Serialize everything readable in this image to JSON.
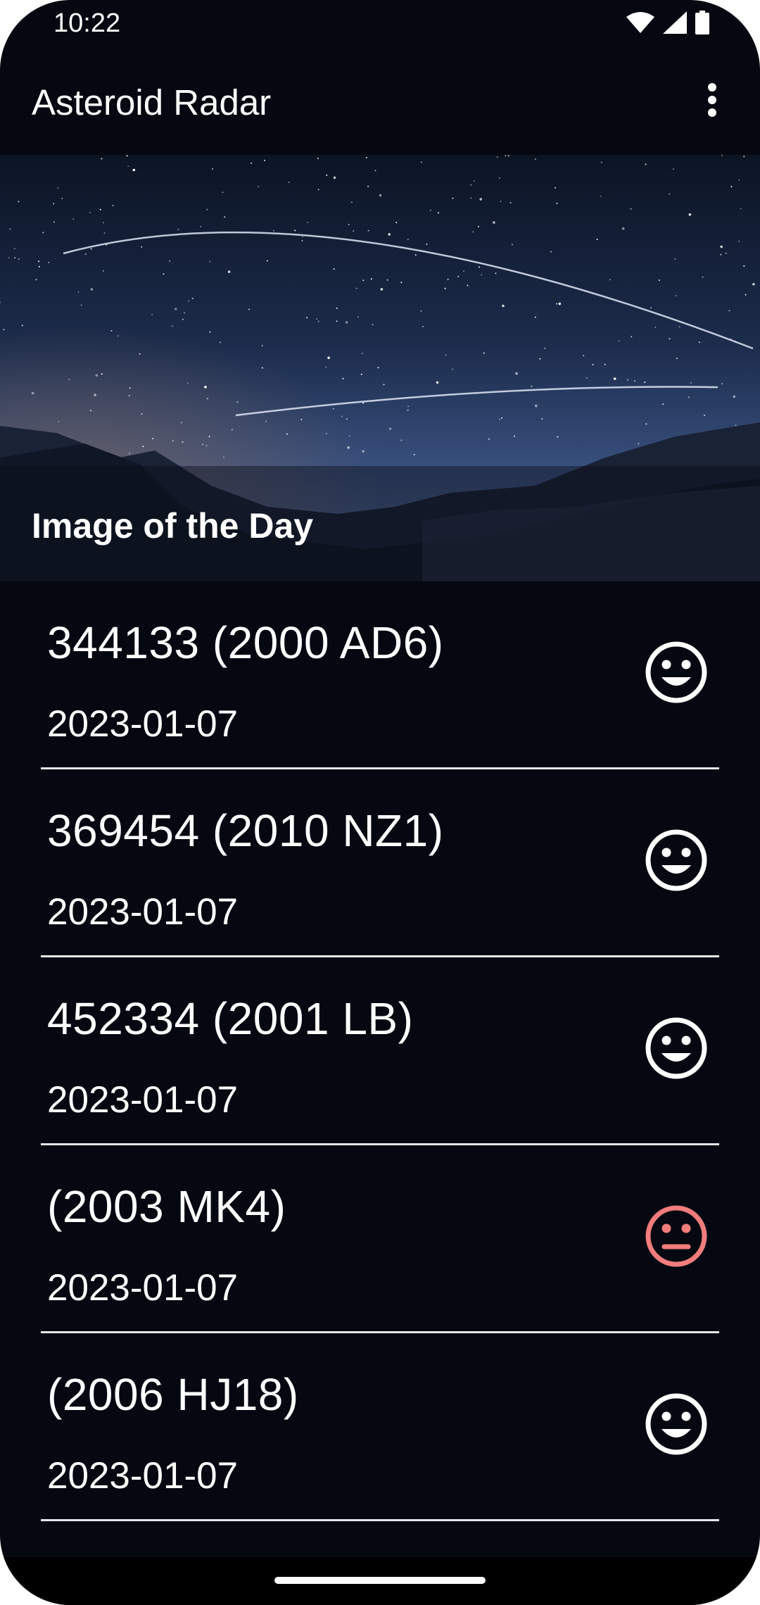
{
  "status_bar": {
    "time": "10:22",
    "icons": [
      "wifi-icon",
      "signal-icon",
      "battery-icon"
    ]
  },
  "app_bar": {
    "title": "Asteroid Radar",
    "menu_icon": "more-vert-icon"
  },
  "image_of_the_day": {
    "caption": "Image of the Day"
  },
  "asteroids": [
    {
      "name": "344133 (2000 AD6)",
      "date": "2023-01-07",
      "status_icon": "happy-face-icon",
      "hazardous": false
    },
    {
      "name": "369454 (2010 NZ1)",
      "date": "2023-01-07",
      "status_icon": "happy-face-icon",
      "hazardous": false
    },
    {
      "name": "452334 (2001 LB)",
      "date": "2023-01-07",
      "status_icon": "happy-face-icon",
      "hazardous": false
    },
    {
      "name": "(2003 MK4)",
      "date": "2023-01-07",
      "status_icon": "neutral-face-icon",
      "hazardous": true
    },
    {
      "name": "(2006 HJ18)",
      "date": "2023-01-07",
      "status_icon": "happy-face-icon",
      "hazardous": false
    }
  ],
  "colors": {
    "background": "#050810",
    "text": "#ffffff",
    "safe_icon": "#ffffff",
    "hazard_icon": "#f07c7c"
  }
}
